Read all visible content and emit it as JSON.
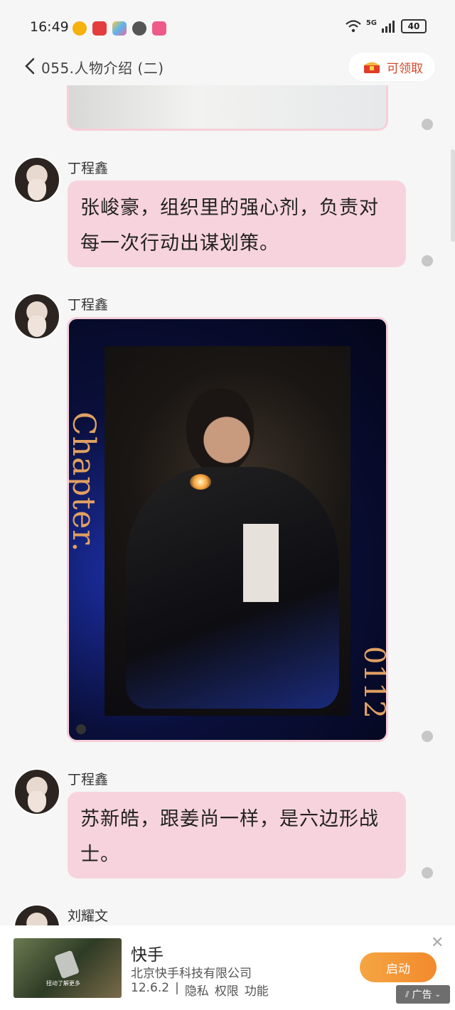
{
  "status_bar": {
    "time": "16:49",
    "network": "5G",
    "battery": "40"
  },
  "header": {
    "back_icon": "chevron-left-icon",
    "title": "055.人物介绍 (二)",
    "reward_label": "可领取",
    "reward_icon": "treasure-chest-icon"
  },
  "messages": [
    {
      "sender": "丁程鑫",
      "text": "张峻豪，组织里的强心剂，负责对每一次行动出谋划策。"
    },
    {
      "sender": "丁程鑫",
      "image_caption_side": "Chapter.",
      "image_caption_bottom": "0112"
    },
    {
      "sender": "丁程鑫",
      "text": "苏新皓，跟姜尚一样，是六边形战士。"
    },
    {
      "sender": "刘耀文"
    }
  ],
  "ad": {
    "title": "快手",
    "company": "北京快手科技有限公司",
    "version": "12.6.2",
    "separator": "|",
    "links": [
      "隐私",
      "权限",
      "功能"
    ],
    "launch_label": "启动",
    "tag": "广告",
    "thumb_text": "扭动了解更多",
    "close_icon": "close-icon"
  },
  "colors": {
    "bubble": "#f7d3dd",
    "accent_orange": "#f28a2c",
    "reward_text": "#d14a2a"
  }
}
